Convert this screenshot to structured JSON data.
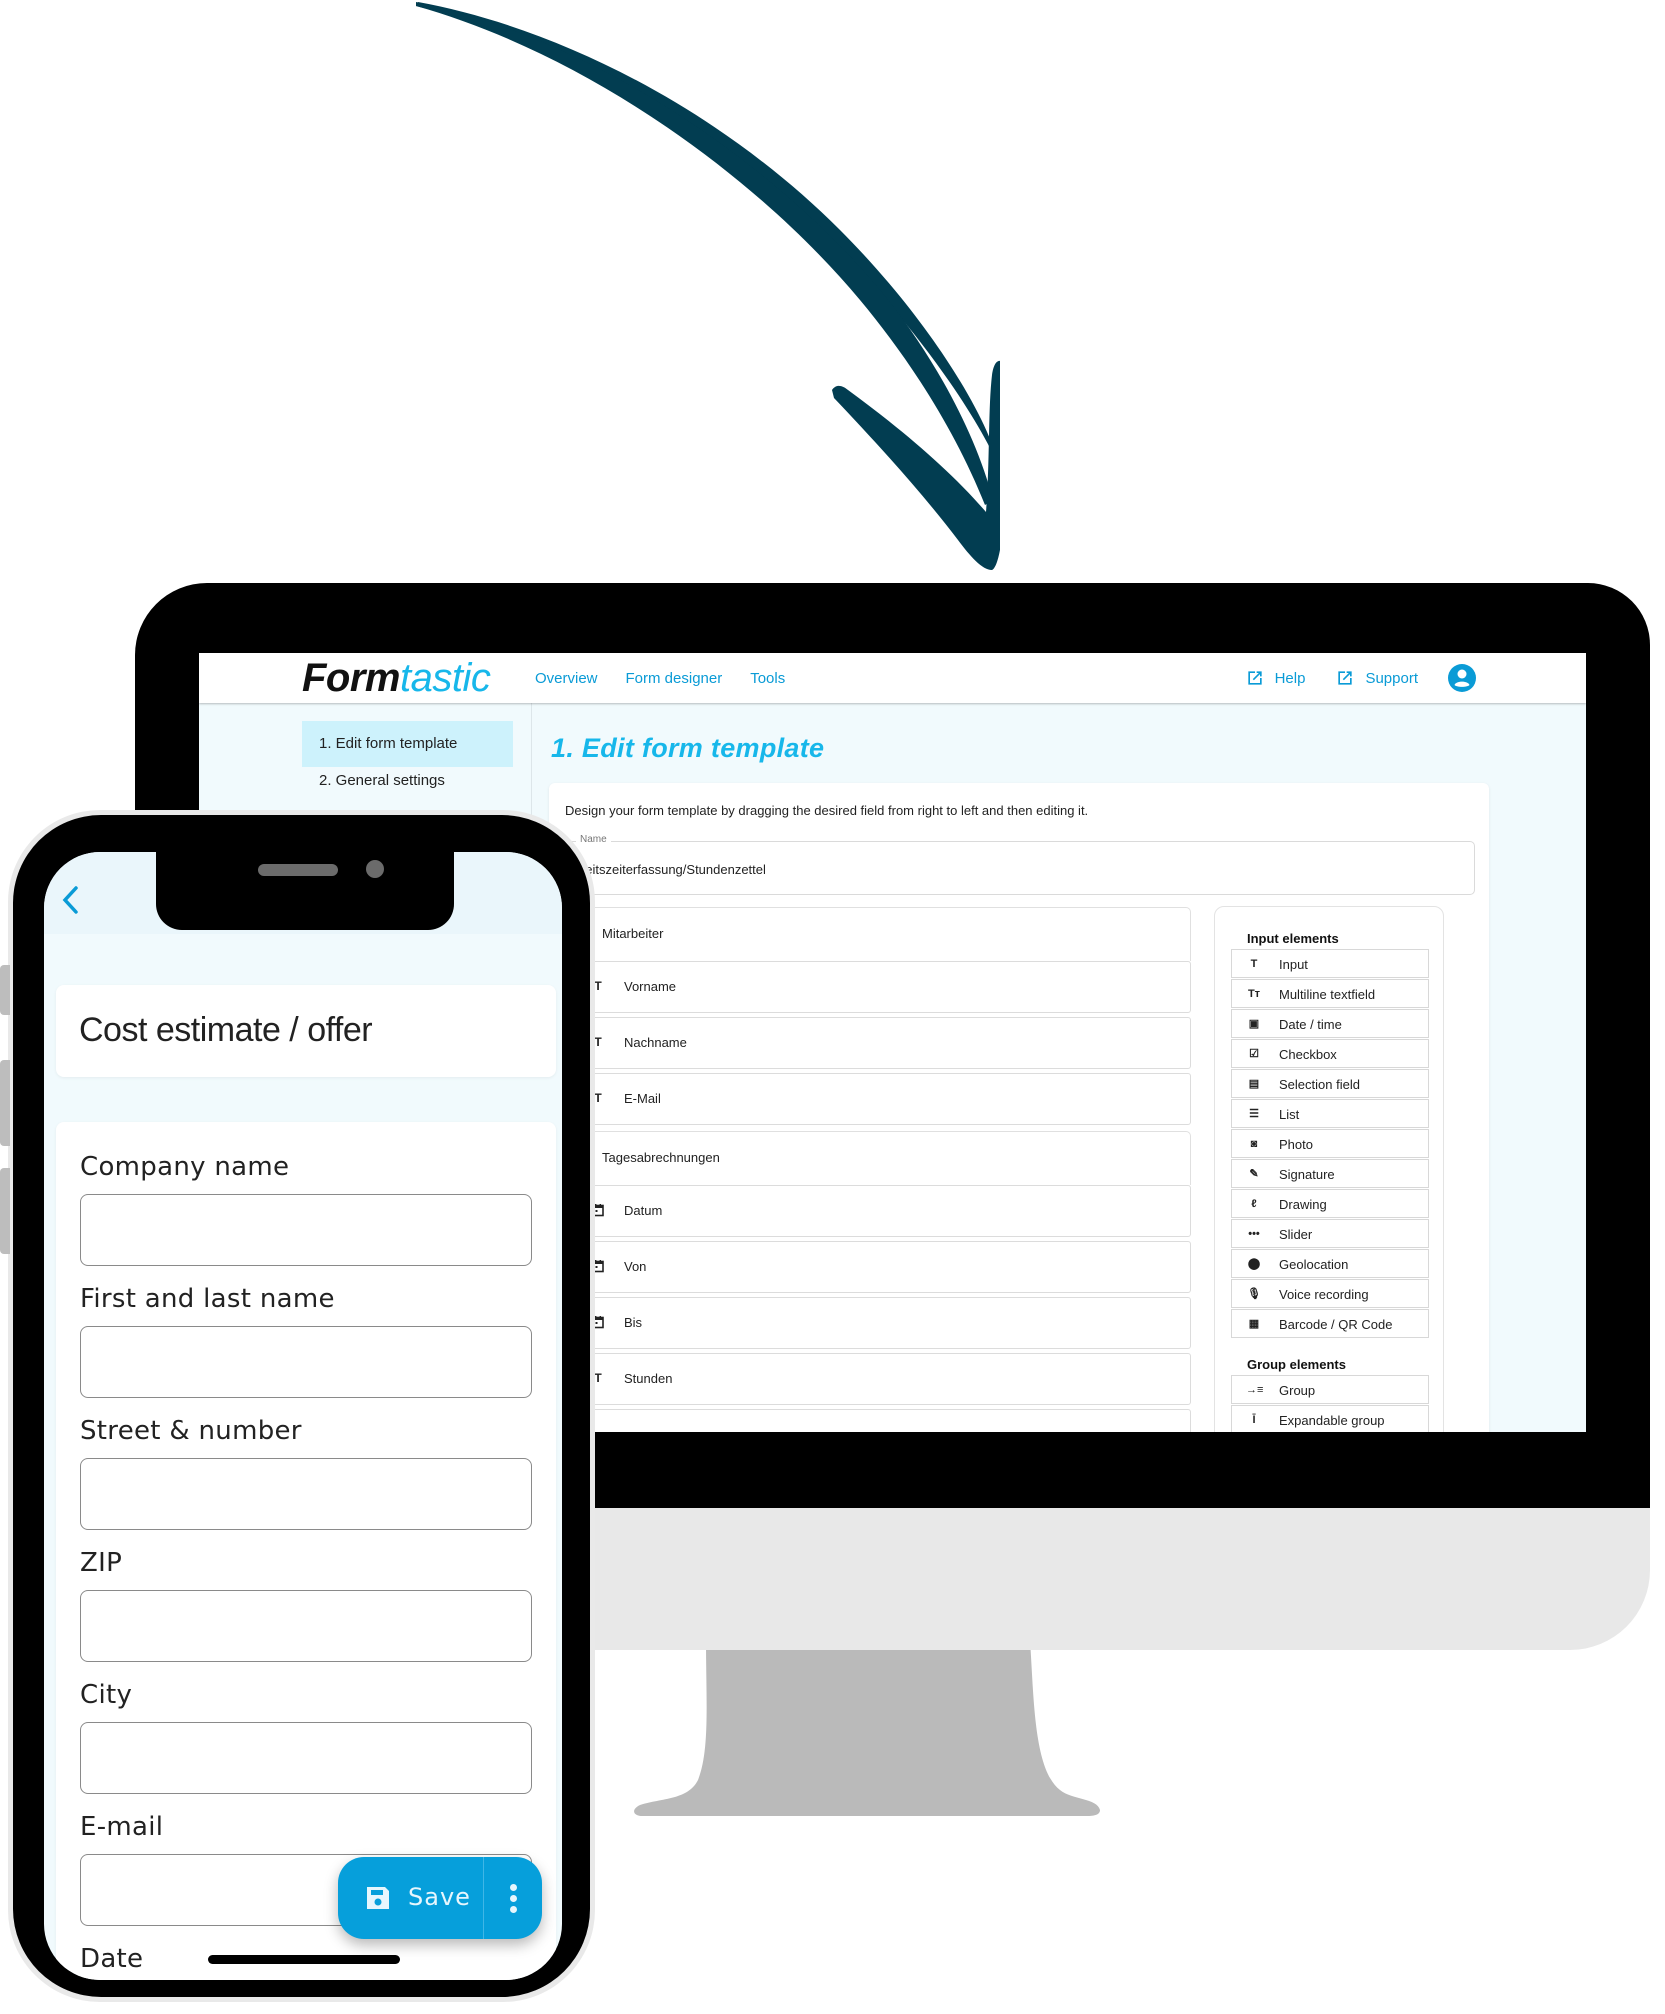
{
  "colors": {
    "arrow": "#023d51",
    "brand_cyan": "#17b7ea",
    "link_blue": "#0a9bd6",
    "fab_blue": "#069fdb",
    "sidebar_active": "#cdf2fc",
    "monitor_chin": "#e8e8e8",
    "monitor_stand": "#bababa"
  },
  "desktop": {
    "logo": {
      "part1": "Form",
      "part2": "tastic"
    },
    "nav": [
      "Overview",
      "Form designer",
      "Tools"
    ],
    "top_right": {
      "help": "Help",
      "support": "Support",
      "help_icon": "external-link-icon",
      "support_icon": "external-link-icon",
      "account_icon": "account-circle-icon"
    },
    "sidebar": {
      "items": [
        {
          "label": "1. Edit form template",
          "active": true
        },
        {
          "label": "2. General settings",
          "active": false
        }
      ]
    },
    "page_title": "1. Edit form template",
    "description": "Design your form template by dragging the desired field from right to left and then editing it.",
    "name_field": {
      "label": "Name",
      "value": "beitszeiterfassung/Stundenzettel"
    },
    "form_fields": [
      {
        "type": "group",
        "label": "Mitarbeiter",
        "icon": "drag-handle-icon"
      },
      {
        "type": "field",
        "label": "Vorname",
        "icon": "text-icon",
        "glyph": "T"
      },
      {
        "type": "field",
        "label": "Nachname",
        "icon": "text-icon",
        "glyph": "T"
      },
      {
        "type": "field",
        "label": "E-Mail",
        "icon": "text-icon",
        "glyph": "T"
      },
      {
        "type": "group",
        "label": "Tagesabrechnungen",
        "icon": "drag-handle-icon"
      },
      {
        "type": "field",
        "label": "Datum",
        "icon": "calendar-icon",
        "glyph": "📅"
      },
      {
        "type": "field",
        "label": "Von",
        "icon": "calendar-icon",
        "glyph": "📅"
      },
      {
        "type": "field",
        "label": "Bis",
        "icon": "calendar-icon",
        "glyph": "📅"
      },
      {
        "type": "field",
        "label": "Stunden",
        "icon": "text-icon",
        "glyph": "T"
      }
    ],
    "palette": {
      "input_heading": "Input elements",
      "input_elements": [
        {
          "label": "Input",
          "icon": "text-icon",
          "glyph": "T"
        },
        {
          "label": "Multiline textfield",
          "icon": "text-size-icon",
          "glyph": "Tт"
        },
        {
          "label": "Date / time",
          "icon": "calendar-icon",
          "glyph": "▣"
        },
        {
          "label": "Checkbox",
          "icon": "checkbox-icon",
          "glyph": "☑"
        },
        {
          "label": "Selection field",
          "icon": "selection-list-icon",
          "glyph": "▤"
        },
        {
          "label": "List",
          "icon": "list-icon",
          "glyph": "☰"
        },
        {
          "label": "Photo",
          "icon": "camera-icon",
          "glyph": "◙"
        },
        {
          "label": "Signature",
          "icon": "pen-icon",
          "glyph": "✎"
        },
        {
          "label": "Drawing",
          "icon": "draw-icon",
          "glyph": "ℓ"
        },
        {
          "label": "Slider",
          "icon": "slider-icon",
          "glyph": "•••"
        },
        {
          "label": "Geolocation",
          "icon": "map-pin-icon",
          "glyph": "⬤"
        },
        {
          "label": "Voice recording",
          "icon": "microphone-icon",
          "glyph": "🎙"
        },
        {
          "label": "Barcode / QR Code",
          "icon": "qr-code-icon",
          "glyph": "▦"
        }
      ],
      "group_heading": "Group elements",
      "group_elements": [
        {
          "label": "Group",
          "icon": "group-indent-icon",
          "glyph": "→≡"
        },
        {
          "label": "Expandable group",
          "icon": "expand-vertical-icon",
          "glyph": "Ī"
        }
      ]
    }
  },
  "mobile": {
    "back_icon": "chevron-left-icon",
    "form_title": "Cost estimate / offer",
    "fields": [
      {
        "label": "Company name",
        "value": ""
      },
      {
        "label": "First and last name",
        "value": ""
      },
      {
        "label": "Street & number",
        "value": ""
      },
      {
        "label": "ZIP",
        "value": ""
      },
      {
        "label": "City",
        "value": ""
      },
      {
        "label": "E-mail",
        "value": ""
      },
      {
        "label": "Date",
        "value": ""
      }
    ],
    "save_button": {
      "label": "Save",
      "icon": "floppy-disk-icon",
      "more_icon": "more-vertical-icon"
    }
  }
}
